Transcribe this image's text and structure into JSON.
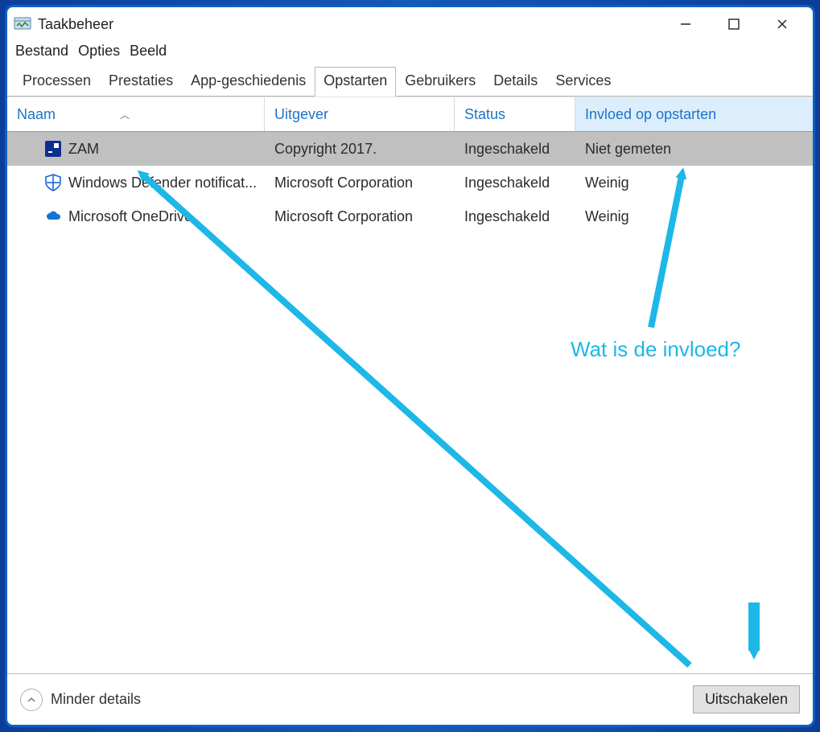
{
  "window": {
    "title": "Taakbeheer"
  },
  "menu": {
    "items": [
      "Bestand",
      "Opties",
      "Beeld"
    ]
  },
  "tabs": {
    "items": [
      "Processen",
      "Prestaties",
      "App-geschiedenis",
      "Opstarten",
      "Gebruikers",
      "Details",
      "Services"
    ],
    "active_index": 3
  },
  "columns": {
    "name": "Naam",
    "publisher": "Uitgever",
    "status": "Status",
    "impact": "Invloed op opstarten",
    "sort_column": "name",
    "sort_direction": "asc"
  },
  "rows": [
    {
      "icon": "zam",
      "name": "ZAM",
      "publisher": "Copyright 2017.",
      "status": "Ingeschakeld",
      "impact": "Niet gemeten",
      "selected": true
    },
    {
      "icon": "shield",
      "name": "Windows Defender notificat...",
      "publisher": "Microsoft Corporation",
      "status": "Ingeschakeld",
      "impact": "Weinig",
      "selected": false
    },
    {
      "icon": "onedrive",
      "name": "Microsoft OneDrive",
      "publisher": "Microsoft Corporation",
      "status": "Ingeschakeld",
      "impact": "Weinig",
      "selected": false
    }
  ],
  "footer": {
    "details": "Minder details",
    "disable": "Uitschakelen"
  },
  "annotation": {
    "question": "Wat is de invloed?",
    "accent": "#1db7e8"
  }
}
